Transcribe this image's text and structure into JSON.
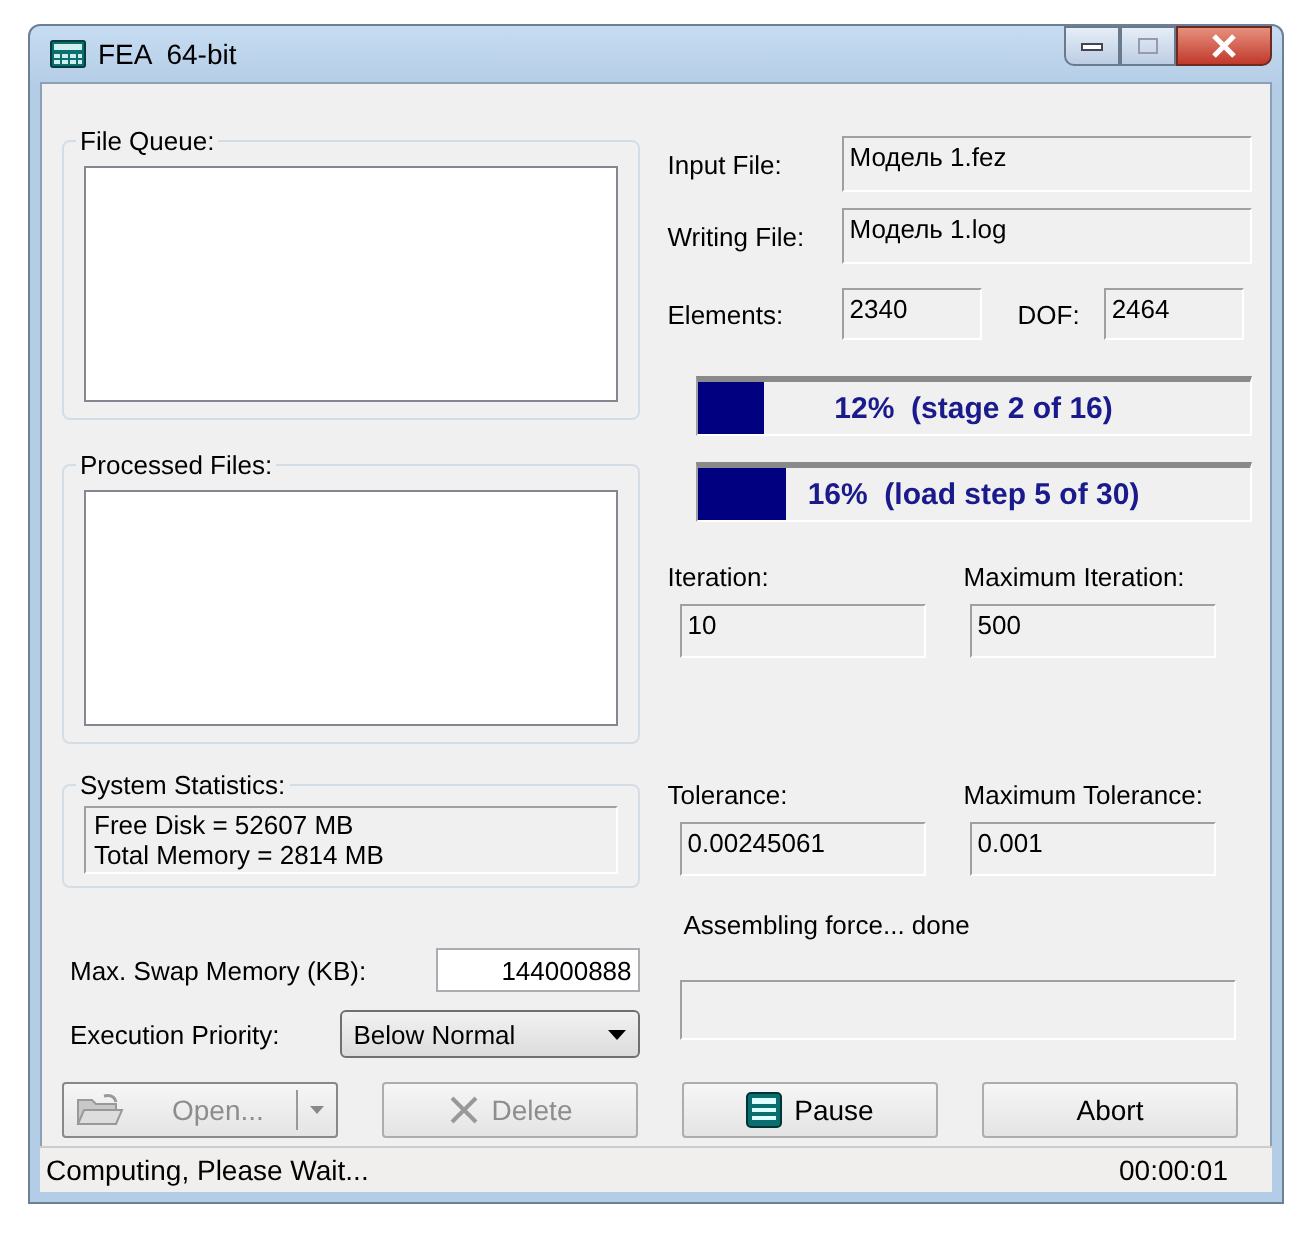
{
  "window": {
    "title": "FEA  64-bit"
  },
  "file_queue": {
    "label": "File Queue:"
  },
  "processed_files": {
    "label": "Processed Files:"
  },
  "system_statistics": {
    "label": "System Statistics:",
    "lines": [
      "Free Disk = 52607 MB",
      "Total Memory = 2814 MB"
    ]
  },
  "swap_memory": {
    "label": "Max. Swap Memory (KB):",
    "value": "144000888"
  },
  "execution_priority": {
    "label": "Execution Priority:",
    "value": "Below Normal"
  },
  "input_file": {
    "label": "Input File:",
    "value": "Модель 1.fez"
  },
  "writing_file": {
    "label": "Writing File:",
    "value": "Модель 1.log"
  },
  "elements": {
    "label": "Elements:",
    "value": "2340"
  },
  "dof": {
    "label": "DOF:",
    "value": "2464"
  },
  "progress": [
    {
      "level": 0.12,
      "text": "12%  (stage 2 of 16)"
    },
    {
      "level": 0.16,
      "text": "16%  (load step 5 of 30)"
    }
  ],
  "iteration": {
    "label": "Iteration:",
    "value": "10"
  },
  "maximum_iteration": {
    "label": "Maximum Iteration:",
    "value": "500"
  },
  "tolerance": {
    "label": "Tolerance:",
    "value": "0.00245061"
  },
  "maximum_tolerance": {
    "label": "Maximum Tolerance:",
    "value": "0.001"
  },
  "message": "Assembling force... done",
  "buttons": [
    {
      "label": "Open...",
      "kind": "split",
      "disabled": true
    },
    {
      "label": "Delete",
      "kind": "delete",
      "disabled": true
    },
    {
      "label": "Pause",
      "kind": "pause",
      "disabled": false
    },
    {
      "label": "Abort",
      "kind": "plain",
      "disabled": false
    }
  ],
  "status_bar": {
    "message": "Computing, Please Wait...",
    "time": "00:00:01"
  }
}
